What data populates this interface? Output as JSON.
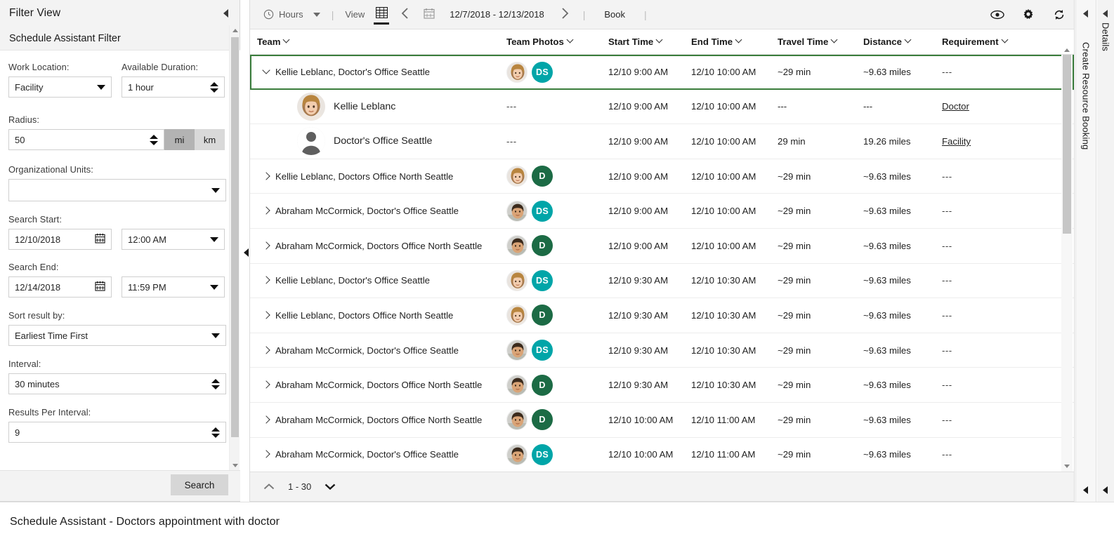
{
  "filter_panel": {
    "title": "Filter View",
    "subtitle": "Schedule Assistant Filter",
    "fields": {
      "work_location_label": "Work Location:",
      "work_location_value": "Facility",
      "available_duration_label": "Available Duration:",
      "available_duration_value": "1 hour",
      "radius_label": "Radius:",
      "radius_value": "50",
      "unit_mi": "mi",
      "unit_km": "km",
      "org_units_label": "Organizational Units:",
      "org_units_value": "",
      "search_start_label": "Search Start:",
      "search_start_date": "12/10/2018",
      "search_start_time": "12:00 AM",
      "search_end_label": "Search End:",
      "search_end_date": "12/14/2018",
      "search_end_time": "11:59 PM",
      "sort_label": "Sort result by:",
      "sort_value": "Earliest Time First",
      "interval_label": "Interval:",
      "interval_value": "30 minutes",
      "results_per_interval_label": "Results Per Interval:",
      "results_per_interval_value": "9"
    },
    "search_button": "Search"
  },
  "toolbar": {
    "hours_label": "Hours",
    "view_label": "View",
    "date_range": "12/7/2018 - 12/13/2018",
    "book_label": "Book",
    "separator": "|",
    "icons": {
      "clock": "clock-icon",
      "grid": "grid-view-icon",
      "prev": "chevron-left-icon",
      "calendar": "calendar-icon",
      "next": "chevron-right-icon",
      "eye": "eye-icon",
      "gear": "gear-icon",
      "refresh": "refresh-icon"
    }
  },
  "grid": {
    "columns": [
      "Team",
      "Team Photos",
      "Start Time",
      "End Time",
      "Travel Time",
      "Distance",
      "Requirement"
    ],
    "rows": [
      {
        "team": "Kellie Leblanc, Doctor's Office Seattle",
        "badge": "DS",
        "badge_color": "#00a5a8",
        "avatar": "female-avatar",
        "start": "12/10 9:00 AM",
        "end": "12/10 10:00 AM",
        "travel": "~29 min",
        "distance": "~9.63 miles",
        "requirement": "---",
        "selected": true,
        "expanded": true,
        "children": [
          {
            "name": "Kellie Leblanc",
            "avatar": "female-avatar",
            "photos": "---",
            "start": "12/10 9:00 AM",
            "end": "12/10 10:00 AM",
            "travel": "---",
            "distance": "---",
            "requirement": "Doctor"
          },
          {
            "name": "Doctor's Office Seattle",
            "avatar": "generic-person-avatar",
            "photos": "---",
            "start": "12/10 9:00 AM",
            "end": "12/10 10:00 AM",
            "travel": "29 min",
            "distance": "19.26 miles",
            "requirement": "Facility"
          }
        ]
      },
      {
        "team": "Kellie Leblanc, Doctors Office North Seattle",
        "badge": "D",
        "badge_color": "#1c6b45",
        "avatar": "female-avatar",
        "start": "12/10 9:00 AM",
        "end": "12/10 10:00 AM",
        "travel": "~29 min",
        "distance": "~9.63 miles",
        "requirement": "---",
        "selected": false,
        "expanded": false
      },
      {
        "team": "Abraham McCormick, Doctor's Office Seattle",
        "badge": "DS",
        "badge_color": "#00a5a8",
        "avatar": "male-avatar",
        "start": "12/10 9:00 AM",
        "end": "12/10 10:00 AM",
        "travel": "~29 min",
        "distance": "~9.63 miles",
        "requirement": "---",
        "selected": false,
        "expanded": false
      },
      {
        "team": "Abraham McCormick, Doctors Office North Seattle",
        "badge": "D",
        "badge_color": "#1c6b45",
        "avatar": "male-avatar",
        "start": "12/10 9:00 AM",
        "end": "12/10 10:00 AM",
        "travel": "~29 min",
        "distance": "~9.63 miles",
        "requirement": "---",
        "selected": false,
        "expanded": false
      },
      {
        "team": "Kellie Leblanc, Doctor's Office Seattle",
        "badge": "DS",
        "badge_color": "#00a5a8",
        "avatar": "female-avatar",
        "start": "12/10 9:30 AM",
        "end": "12/10 10:30 AM",
        "travel": "~29 min",
        "distance": "~9.63 miles",
        "requirement": "---",
        "selected": false,
        "expanded": false
      },
      {
        "team": "Kellie Leblanc, Doctors Office North Seattle",
        "badge": "D",
        "badge_color": "#1c6b45",
        "avatar": "female-avatar",
        "start": "12/10 9:30 AM",
        "end": "12/10 10:30 AM",
        "travel": "~29 min",
        "distance": "~9.63 miles",
        "requirement": "---",
        "selected": false,
        "expanded": false
      },
      {
        "team": "Abraham McCormick, Doctor's Office Seattle",
        "badge": "DS",
        "badge_color": "#00a5a8",
        "avatar": "male-avatar",
        "start": "12/10 9:30 AM",
        "end": "12/10 10:30 AM",
        "travel": "~29 min",
        "distance": "~9.63 miles",
        "requirement": "---",
        "selected": false,
        "expanded": false
      },
      {
        "team": "Abraham McCormick, Doctors Office North Seattle",
        "badge": "D",
        "badge_color": "#1c6b45",
        "avatar": "male-avatar",
        "start": "12/10 9:30 AM",
        "end": "12/10 10:30 AM",
        "travel": "~29 min",
        "distance": "~9.63 miles",
        "requirement": "---",
        "selected": false,
        "expanded": false
      },
      {
        "team": "Abraham McCormick, Doctors Office North Seattle",
        "badge": "D",
        "badge_color": "#1c6b45",
        "avatar": "male-avatar",
        "start": "12/10 10:00 AM",
        "end": "12/10 11:00 AM",
        "travel": "~29 min",
        "distance": "~9.63 miles",
        "requirement": "---",
        "selected": false,
        "expanded": false
      },
      {
        "team": "Abraham McCormick, Doctor's Office Seattle",
        "badge": "DS",
        "badge_color": "#00a5a8",
        "avatar": "male-avatar",
        "start": "12/10 10:00 AM",
        "end": "12/10 11:00 AM",
        "travel": "~29 min",
        "distance": "~9.63 miles",
        "requirement": "---",
        "selected": false,
        "expanded": false
      }
    ],
    "pager_label": "1 - 30"
  },
  "rails": {
    "create_resource_booking": "Create Resource Booking",
    "details": "Details"
  },
  "status_bar": {
    "text": "Schedule Assistant - Doctors appointment with doctor"
  },
  "colors": {
    "selection_border": "#3a7d3c",
    "badge_teal": "#00a5a8",
    "badge_green": "#1c6b45",
    "panel_bg": "#f3f3f3"
  }
}
